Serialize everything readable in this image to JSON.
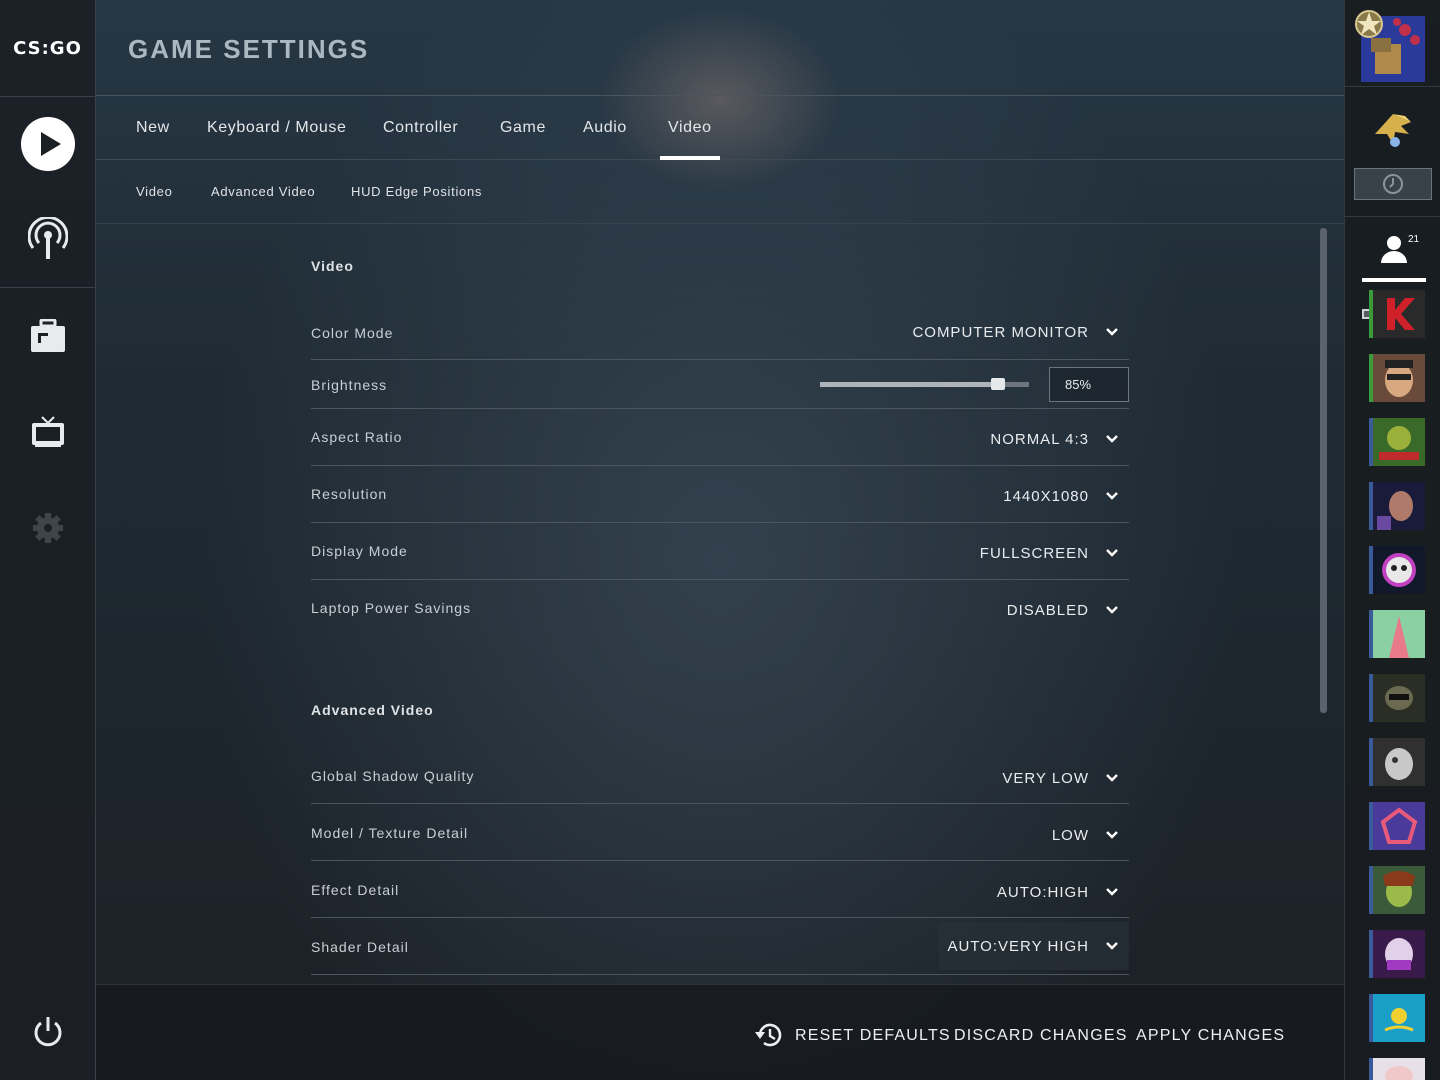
{
  "app": {
    "logo_text": "CS:GO",
    "page_title": "GAME SETTINGS"
  },
  "tabs": [
    {
      "label": "New"
    },
    {
      "label": "Keyboard / Mouse"
    },
    {
      "label": "Controller"
    },
    {
      "label": "Game"
    },
    {
      "label": "Audio"
    },
    {
      "label": "Video",
      "active": true
    }
  ],
  "subtabs": [
    {
      "label": "Video"
    },
    {
      "label": "Advanced Video"
    },
    {
      "label": "HUD Edge Positions"
    }
  ],
  "sections": {
    "video": {
      "title": "Video",
      "color_mode": {
        "label": "Color Mode",
        "value": "COMPUTER MONITOR"
      },
      "brightness": {
        "label": "Brightness",
        "value_text": "85%",
        "percent": 85
      },
      "aspect_ratio": {
        "label": "Aspect Ratio",
        "value": "NORMAL 4:3"
      },
      "resolution": {
        "label": "Resolution",
        "value": "1440X1080"
      },
      "display_mode": {
        "label": "Display Mode",
        "value": "FULLSCREEN"
      },
      "laptop_power": {
        "label": "Laptop Power Savings",
        "value": "DISABLED"
      }
    },
    "advanced": {
      "title": "Advanced Video",
      "shadow": {
        "label": "Global Shadow Quality",
        "value": "VERY LOW"
      },
      "model_texture": {
        "label": "Model / Texture Detail",
        "value": "LOW"
      },
      "effect": {
        "label": "Effect Detail",
        "value": "AUTO:HIGH"
      },
      "shader": {
        "label": "Shader Detail",
        "value": "AUTO:VERY HIGH"
      }
    }
  },
  "footer": {
    "reset": "RESET DEFAULTS",
    "discard": "DISCARD CHANGES",
    "apply": "APPLY CHANGES"
  },
  "friends": {
    "count": "21"
  },
  "colors": {
    "accent": "#ffffff",
    "online": "#3b9b3b",
    "offline": "#3a5a9a"
  }
}
